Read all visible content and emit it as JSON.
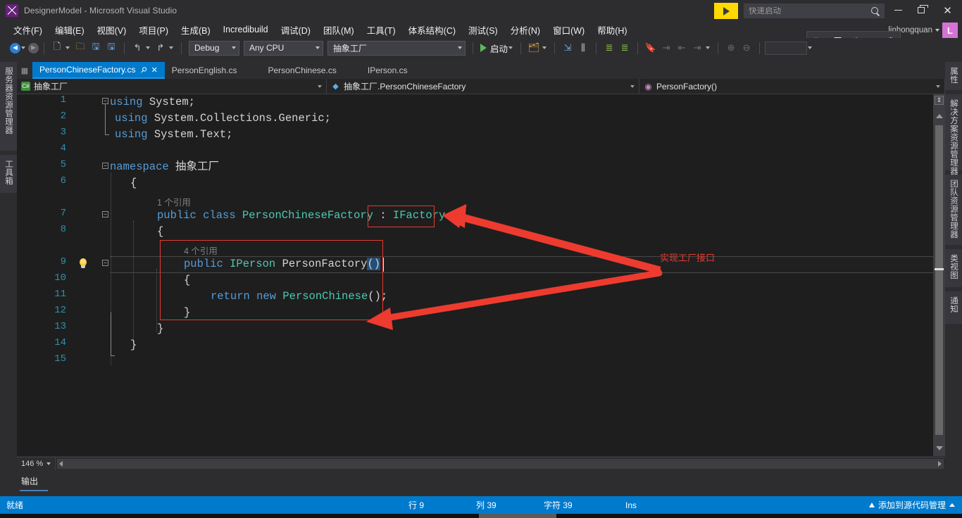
{
  "window": {
    "title": "DesignerModel - Microsoft Visual Studio",
    "logo_icon": "visual-studio-logo",
    "minimize_icon": "minimize-icon",
    "maximize_icon": "maximize-restore-icon",
    "close_icon": "close-icon",
    "feedback_icon": "feedback-flag-icon"
  },
  "quick_launch": {
    "placeholder": "快速启动",
    "value": "",
    "search_icon": "search-icon"
  },
  "account": {
    "name": "linhongquan",
    "avatar_initial": "L",
    "caret_icon": "chevron-down-icon"
  },
  "menubar": {
    "items": [
      {
        "label": "文件(F)"
      },
      {
        "label": "编辑(E)"
      },
      {
        "label": "视图(V)"
      },
      {
        "label": "项目(P)"
      },
      {
        "label": "生成(B)"
      },
      {
        "label": "Incredibuild"
      },
      {
        "label": "调试(D)"
      },
      {
        "label": "团队(M)"
      },
      {
        "label": "工具(T)"
      },
      {
        "label": "体系结构(C)"
      },
      {
        "label": "测试(S)"
      },
      {
        "label": "分析(N)"
      },
      {
        "label": "窗口(W)"
      },
      {
        "label": "帮助(H)"
      }
    ]
  },
  "ime_bar": {
    "items": [
      "paw-icon",
      "五",
      "moon-icon",
      "comma-icon",
      "gear-icon"
    ],
    "paw": "🐾",
    "mode": "五",
    "moon": "☽",
    "punct": "°,",
    "gear": "⚙"
  },
  "toolbar": {
    "back_icon": "navigate-back-icon",
    "forward_icon": "navigate-forward-icon",
    "new_item_icon": "new-item-icon",
    "open_icon": "open-file-icon",
    "save_icon": "save-icon",
    "save_all_icon": "save-all-icon",
    "undo_icon": "undo-icon",
    "redo_icon": "redo-icon",
    "config_value": "Debug",
    "platform_value": "Any CPU",
    "startup_project_value": "抽象工厂",
    "run_label": "启动",
    "run_icon": "play-icon",
    "attach_icon": "attach-process-icon",
    "step_over_icon": "step-over-icon",
    "step_into_icon": "step-into-icon",
    "indent_icon": "indent-icon",
    "outdent_icon": "outdent-icon",
    "bookmark_icon": "bookmark-icon",
    "next_bm_icon": "next-bookmark-icon",
    "prev_bm_icon": "prev-bookmark-icon",
    "clear_bm_icon": "clear-bookmark-icon",
    "zoom_in_icon": "zoom-in-icon",
    "zoom_out_icon": "zoom-out-icon"
  },
  "left_rail": {
    "tabs": [
      "服务器资源管理器",
      "工具箱"
    ]
  },
  "right_rail": {
    "tabs": [
      "属性",
      "解决方案资源管理器",
      "团队资源管理器",
      "类视图",
      "通知"
    ]
  },
  "document_tabs": {
    "strip_icon": "document-well-icon",
    "tabs": [
      {
        "label": "PersonChineseFactory.cs",
        "active": true,
        "pin_icon": "pin-icon",
        "close_icon": "close-tab-icon"
      },
      {
        "label": "PersonEnglish.cs",
        "active": false
      },
      {
        "label": "PersonChinese.cs",
        "active": false
      },
      {
        "label": "IPerson.cs",
        "active": false
      }
    ]
  },
  "nav_bar": {
    "project": "抽象工厂",
    "project_icon": "csharp-project-icon",
    "type": "抽象工厂.PersonChineseFactory",
    "type_icon": "class-icon",
    "member": "PersonFactory()",
    "member_icon": "method-icon",
    "caret_icon": "chevron-down-icon"
  },
  "editor": {
    "language": "csharp",
    "zoom": "146 %",
    "zoom_caret_icon": "chevron-down-icon",
    "bulb_icon": "lightbulb-quick-action-icon",
    "line_numbers": [
      "1",
      "2",
      "3",
      "4",
      "5",
      "6",
      "7",
      "8",
      "9",
      "10",
      "11",
      "12",
      "13",
      "14",
      "15"
    ],
    "lines": [
      {
        "n": 1,
        "text": "using System;"
      },
      {
        "n": 2,
        "text": "using System.Collections.Generic;"
      },
      {
        "n": 3,
        "text": "using System.Text;"
      },
      {
        "n": 4,
        "text": ""
      },
      {
        "n": 5,
        "text": "namespace 抽象工厂"
      },
      {
        "n": 6,
        "text": "{"
      },
      {
        "n": 7,
        "text": "    public class PersonChineseFactory : IFactory"
      },
      {
        "n": 8,
        "text": "    {"
      },
      {
        "n": 9,
        "text": "        public IPerson PersonFactory()"
      },
      {
        "n": 10,
        "text": "        {"
      },
      {
        "n": 11,
        "text": "            return new PersonChinese();"
      },
      {
        "n": 12,
        "text": "        }"
      },
      {
        "n": 13,
        "text": "    }"
      },
      {
        "n": 14,
        "text": "}"
      },
      {
        "n": 15,
        "text": ""
      }
    ],
    "codelens": [
      {
        "on_line": 7,
        "label": "1 个引用"
      },
      {
        "on_line": 9,
        "label": "4 个引用"
      }
    ],
    "tokens": {
      "using": "using",
      "system": "System;",
      "system_collections": "System.Collections.Generic;",
      "system_text": "System.Text;",
      "namespace_kw": "namespace",
      "namespace_name": "抽象工厂",
      "brace_open": "{",
      "brace_close": "}",
      "public": "public",
      "class_kw": "class",
      "class_name": "PersonChineseFactory",
      "colon": ":",
      "interface_name": "IFactory",
      "return_type": "IPerson",
      "method_name": "PersonFactory",
      "method_parens": "()",
      "return_kw": "return",
      "new_kw": "new",
      "ctor_name": "PersonChinese",
      "ctor_call": "();"
    }
  },
  "annotations": {
    "red_note": "实现工厂接口",
    "red_color": "#e8392f",
    "boxes": [
      "interface-name-box",
      "method-body-box"
    ],
    "arrows": [
      "arrow-to-interface",
      "arrow-to-method-body"
    ]
  },
  "output_panel": {
    "tab_label": "输出"
  },
  "status_bar": {
    "ready": "就绪",
    "line_label": "行 9",
    "col_label": "列 39",
    "char_label": "字符 39",
    "insert_mode": "Ins",
    "source_control": "添加到源代码管理",
    "up_icon": "arrow-up-icon",
    "caret_icon": "chevron-up-icon",
    "accent_color": "#007acc"
  }
}
